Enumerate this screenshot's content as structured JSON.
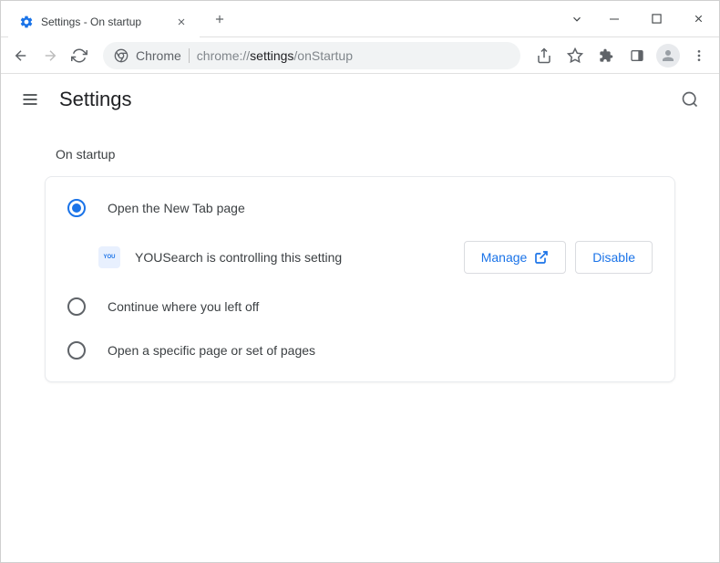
{
  "tab": {
    "title": "Settings - On startup"
  },
  "address": {
    "prefix": "Chrome",
    "protocol": "chrome://",
    "path_emphasis": "settings",
    "path_rest": "/onStartup"
  },
  "header": {
    "title": "Settings"
  },
  "section": {
    "label": "On startup"
  },
  "options": {
    "0": {
      "label": "Open the New Tab page",
      "selected": true
    },
    "1": {
      "label": "Continue where you left off",
      "selected": false
    },
    "2": {
      "label": "Open a specific page or set of pages",
      "selected": false
    }
  },
  "extension_notice": {
    "name": "YOUSearch",
    "text": "YOUSearch is controlling this setting",
    "manage_label": "Manage",
    "disable_label": "Disable"
  }
}
